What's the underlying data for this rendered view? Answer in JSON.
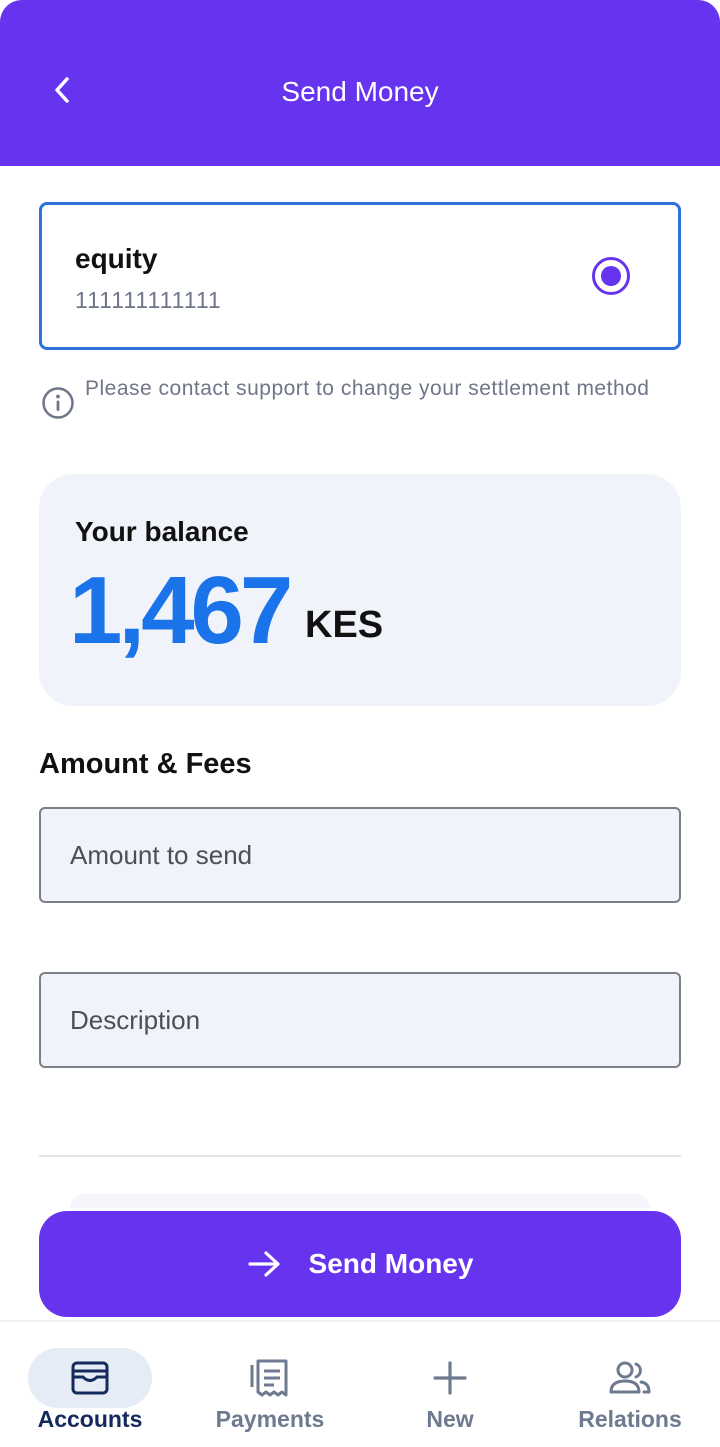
{
  "header": {
    "title": "Send Money",
    "back_icon": "chevron-left-icon",
    "background": "#6633ee"
  },
  "settlement_account": {
    "name": "equity",
    "number": "111111111111",
    "selected": true
  },
  "info_note": {
    "icon": "info-icon",
    "text": "Please contact support to change your settlement method"
  },
  "balance": {
    "label": "Your balance",
    "amount": "1,467",
    "currency": "KES",
    "amount_color": "#1a73e8"
  },
  "amount_fees": {
    "title": "Amount & Fees",
    "amount_placeholder": "Amount to send",
    "description_placeholder": "Description"
  },
  "send_button": {
    "label": "Send Money",
    "icon": "arrow-right-icon"
  },
  "bottom_nav": {
    "items": [
      {
        "label": "Accounts",
        "icon": "wallet-icon",
        "active": true
      },
      {
        "label": "Payments",
        "icon": "receipt-icon",
        "active": false
      },
      {
        "label": "New",
        "icon": "plus-icon",
        "active": false
      },
      {
        "label": "Relations",
        "icon": "people-icon",
        "active": false
      }
    ]
  },
  "colors": {
    "primary": "#6633ee",
    "selected_border": "#2f73d9",
    "nav_active": "#152a5c",
    "nav_inactive": "#6e7a8f"
  }
}
